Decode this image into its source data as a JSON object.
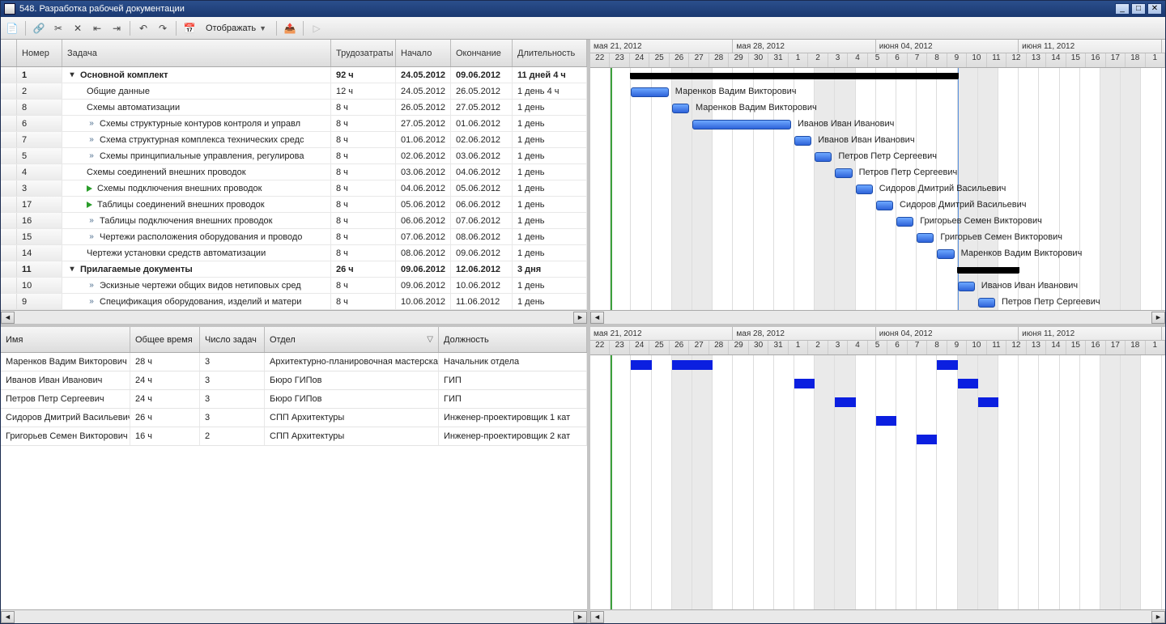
{
  "window": {
    "title": "548. Разработка рабочей документации"
  },
  "toolbar": {
    "display_label": "Отображать"
  },
  "columns": {
    "number": "Номер",
    "task": "Задача",
    "labor": "Трудозатраты",
    "start": "Начало",
    "end": "Окончание",
    "duration": "Длительность"
  },
  "tasks": [
    {
      "num": "1",
      "name": "Основной комплект",
      "labor": "92 ч",
      "start": "24.05.2012",
      "end": "09.06.2012",
      "dur": "11 дней 4 ч",
      "bold": true,
      "indent": 0,
      "icon": "collapse",
      "summary": true,
      "bar_start": 2,
      "bar_span": 16
    },
    {
      "num": "2",
      "name": "Общие данные",
      "labor": "12 ч",
      "start": "24.05.2012",
      "end": "26.05.2012",
      "dur": "1 день 4 ч",
      "indent": 2,
      "bar_start": 2,
      "bar_span": 2,
      "assignee": "Маренков Вадим Викторович"
    },
    {
      "num": "8",
      "name": "Схемы автоматизации",
      "labor": "8 ч",
      "start": "26.05.2012",
      "end": "27.05.2012",
      "dur": "1 день",
      "indent": 2,
      "bar_start": 4,
      "bar_span": 1,
      "assignee": "Маренков Вадим Викторович"
    },
    {
      "num": "6",
      "name": "Схемы структурные контуров контроля и управл",
      "labor": "8 ч",
      "start": "27.05.2012",
      "end": "01.06.2012",
      "dur": "1 день",
      "indent": 2,
      "icon": "link",
      "bar_start": 5,
      "bar_span": 5,
      "assignee": "Иванов Иван Иванович"
    },
    {
      "num": "7",
      "name": "Схема структурная комплекса технических средс",
      "labor": "8 ч",
      "start": "01.06.2012",
      "end": "02.06.2012",
      "dur": "1 день",
      "indent": 2,
      "icon": "link",
      "bar_start": 10,
      "bar_span": 1,
      "assignee": "Иванов Иван Иванович"
    },
    {
      "num": "5",
      "name": "Схемы принципиальные управления, регулирова",
      "labor": "8 ч",
      "start": "02.06.2012",
      "end": "03.06.2012",
      "dur": "1 день",
      "indent": 2,
      "icon": "link",
      "bar_start": 11,
      "bar_span": 1,
      "assignee": "Петров Петр Сергеевич"
    },
    {
      "num": "4",
      "name": "Схемы соединений внешних проводок",
      "labor": "8 ч",
      "start": "03.06.2012",
      "end": "04.06.2012",
      "dur": "1 день",
      "indent": 2,
      "bar_start": 12,
      "bar_span": 1,
      "assignee": "Петров Петр Сергеевич"
    },
    {
      "num": "3",
      "name": "Схемы подключения внешних проводок",
      "labor": "8 ч",
      "start": "04.06.2012",
      "end": "05.06.2012",
      "dur": "1 день",
      "indent": 2,
      "icon": "play",
      "bar_start": 13,
      "bar_span": 1,
      "assignee": "Сидоров Дмитрий Васильевич"
    },
    {
      "num": "17",
      "name": "Таблицы соединений внешних проводок",
      "labor": "8 ч",
      "start": "05.06.2012",
      "end": "06.06.2012",
      "dur": "1 день",
      "indent": 2,
      "icon": "play",
      "bar_start": 14,
      "bar_span": 1,
      "assignee": "Сидоров Дмитрий Васильевич"
    },
    {
      "num": "16",
      "name": "Таблицы подключения внешних проводок",
      "labor": "8 ч",
      "start": "06.06.2012",
      "end": "07.06.2012",
      "dur": "1 день",
      "indent": 2,
      "icon": "link",
      "bar_start": 15,
      "bar_span": 1,
      "assignee": "Григорьев Семен Викторович"
    },
    {
      "num": "15",
      "name": "Чертежи расположения оборудования и проводо",
      "labor": "8 ч",
      "start": "07.06.2012",
      "end": "08.06.2012",
      "dur": "1 день",
      "indent": 2,
      "icon": "link",
      "bar_start": 16,
      "bar_span": 1,
      "assignee": "Григорьев Семен Викторович"
    },
    {
      "num": "14",
      "name": "Чертежи установки средств автоматизации",
      "labor": "8 ч",
      "start": "08.06.2012",
      "end": "09.06.2012",
      "dur": "1 день",
      "indent": 2,
      "bar_start": 17,
      "bar_span": 1,
      "assignee": "Маренков Вадим Викторович"
    },
    {
      "num": "11",
      "name": "Прилагаемые документы",
      "labor": "26 ч",
      "start": "09.06.2012",
      "end": "12.06.2012",
      "dur": "3 дня",
      "bold": true,
      "indent": 0,
      "icon": "collapse",
      "summary": true,
      "bar_start": 18,
      "bar_span": 3
    },
    {
      "num": "10",
      "name": "Эскизные чертежи общих видов нетиповых сред",
      "labor": "8 ч",
      "start": "09.06.2012",
      "end": "10.06.2012",
      "dur": "1 день",
      "indent": 2,
      "icon": "link",
      "bar_start": 18,
      "bar_span": 1,
      "assignee": "Иванов Иван Иванович"
    },
    {
      "num": "9",
      "name": "Спецификация оборудования, изделий и матери",
      "labor": "8 ч",
      "start": "10.06.2012",
      "end": "11.06.2012",
      "dur": "1 день",
      "indent": 2,
      "icon": "link",
      "bar_start": 19,
      "bar_span": 1,
      "assignee": "Петров Петр Сергеевич"
    }
  ],
  "timeline": {
    "day_width": 25.2,
    "weeks": [
      {
        "label": "мая 21, 2012",
        "span": 7
      },
      {
        "label": "мая 28, 2012",
        "span": 7
      },
      {
        "label": "июня 04, 2012",
        "span": 7
      },
      {
        "label": "июня 11, 2012",
        "span": 7
      }
    ],
    "days": [
      "22",
      "23",
      "24",
      "25",
      "26",
      "27",
      "28",
      "29",
      "30",
      "31",
      "1",
      "2",
      "3",
      "4",
      "5",
      "6",
      "7",
      "8",
      "9",
      "10",
      "11",
      "12",
      "13",
      "14",
      "15",
      "16",
      "17",
      "18",
      "1"
    ],
    "weekends": [
      4,
      5,
      11,
      12,
      18,
      19,
      25,
      26
    ],
    "today_idx": 1,
    "blue_line_idx": 18
  },
  "res_columns": {
    "name": "Имя",
    "time": "Общее время",
    "count": "Число задач",
    "dept": "Отдел",
    "pos": "Должность"
  },
  "resources": [
    {
      "name": "Маренков Вадим Викторович",
      "time": "28 ч",
      "count": "3",
      "dept": "Архитектурно-планировочная мастерская",
      "pos": "Начальник отдела",
      "bars": [
        {
          "s": 2,
          "w": 1
        },
        {
          "s": 4,
          "w": 2
        },
        {
          "s": 17,
          "w": 1
        }
      ]
    },
    {
      "name": "Иванов Иван Иванович",
      "time": "24 ч",
      "count": "3",
      "dept": "Бюро ГИПов",
      "pos": "ГИП",
      "bars": [
        {
          "s": 10,
          "w": 1
        },
        {
          "s": 18,
          "w": 1
        }
      ]
    },
    {
      "name": "Петров Петр Сергеевич",
      "time": "24 ч",
      "count": "3",
      "dept": "Бюро ГИПов",
      "pos": "ГИП",
      "bars": [
        {
          "s": 12,
          "w": 1
        },
        {
          "s": 19,
          "w": 1
        }
      ]
    },
    {
      "name": "Сидоров Дмитрий Васильевич",
      "time": "26 ч",
      "count": "3",
      "dept": "СПП Архитектуры",
      "pos": "Инженер-проектировщик 1 кат",
      "bars": [
        {
          "s": 14,
          "w": 1
        }
      ]
    },
    {
      "name": "Григорьев Семен Викторович",
      "time": "16 ч",
      "count": "2",
      "dept": "СПП Архитектуры",
      "pos": "Инженер-проектировщик 2 кат",
      "bars": [
        {
          "s": 16,
          "w": 1
        }
      ]
    }
  ]
}
